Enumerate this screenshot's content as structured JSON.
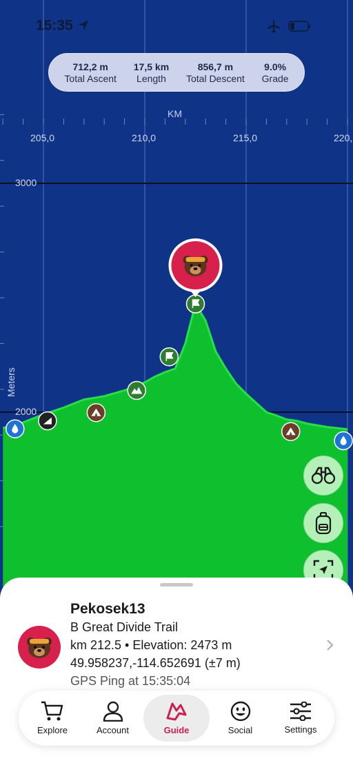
{
  "status_bar": {
    "time": "15:35"
  },
  "stats": [
    {
      "value": "712,2 m",
      "label": "Total Ascent"
    },
    {
      "value": "17,5 km",
      "label": "Length"
    },
    {
      "value": "856,7 m",
      "label": "Total Descent"
    },
    {
      "value": "9.0%",
      "label": "Grade"
    }
  ],
  "chart_data": {
    "type": "area",
    "xlabel": "KM",
    "ylabel": "Meters",
    "x_ticks": [
      "205,0",
      "210,0",
      "215,0",
      "220,"
    ],
    "y_ticks": [
      "3000",
      "2000"
    ],
    "fill_color": "#0fc02e",
    "background_color": "#0f3386",
    "series": [
      {
        "x": [
          203.0,
          204.0,
          205.0,
          206.0,
          207.0,
          208.0,
          209.0,
          210.0,
          210.5,
          211.0,
          211.5,
          212.0,
          212.5,
          213.0,
          213.5,
          214.0,
          214.5,
          215.0,
          215.5,
          216.0,
          216.5,
          217.0,
          217.5,
          218.0,
          219.0,
          220.0
        ],
        "y": [
          1930,
          1955,
          1990,
          2020,
          2055,
          2070,
          2095,
          2130,
          2155,
          2175,
          2190,
          2300,
          2473,
          2400,
          2265,
          2190,
          2125,
          2080,
          2040,
          2000,
          1985,
          1968,
          1962,
          1950,
          1935,
          1925
        ]
      }
    ],
    "waypoints": [
      {
        "x": 203.6,
        "y": 1927,
        "kind": "water",
        "color": "#1e73d6"
      },
      {
        "x": 205.2,
        "y": 1962,
        "kind": "trailhead",
        "color": "#222222"
      },
      {
        "x": 207.6,
        "y": 1998,
        "kind": "campsite",
        "color": "#6a3f26"
      },
      {
        "x": 209.6,
        "y": 2095,
        "kind": "mountain",
        "color": "#2f7d32"
      },
      {
        "x": 211.2,
        "y": 2242,
        "kind": "flag",
        "color": "#2f7d32"
      },
      {
        "x": 212.5,
        "y": 2473,
        "kind": "flag",
        "color": "#2f7d32"
      },
      {
        "x": 217.2,
        "y": 1915,
        "kind": "campsite",
        "color": "#6a3f26"
      },
      {
        "x": 219.8,
        "y": 1875,
        "kind": "water",
        "color": "#1e73d6"
      }
    ]
  },
  "fabs": [
    {
      "icon": "binoculars-icon"
    },
    {
      "icon": "backpack-icon"
    },
    {
      "icon": "locate-icon"
    }
  ],
  "hiker": {
    "name": "Pekosek13",
    "trail": "B Great Divide Trail",
    "km_elevation": "km 212.5 • Elevation: 2473 m",
    "coords": "49.958237,-114.652691 (±7 m)",
    "ping": "GPS Ping at 15:35:04"
  },
  "tabs": [
    {
      "label": "Explore",
      "icon": "cart-icon",
      "active": false
    },
    {
      "label": "Account",
      "icon": "person-icon",
      "active": false
    },
    {
      "label": "Guide",
      "icon": "guide-icon",
      "active": true
    },
    {
      "label": "Social",
      "icon": "smiley-icon",
      "active": false
    },
    {
      "label": "Settings",
      "icon": "sliders-icon",
      "active": false
    }
  ],
  "colors": {
    "accent": "#cc2050",
    "avatar_bg": "#d8204d",
    "fab_bg": "#b5f0b8"
  }
}
